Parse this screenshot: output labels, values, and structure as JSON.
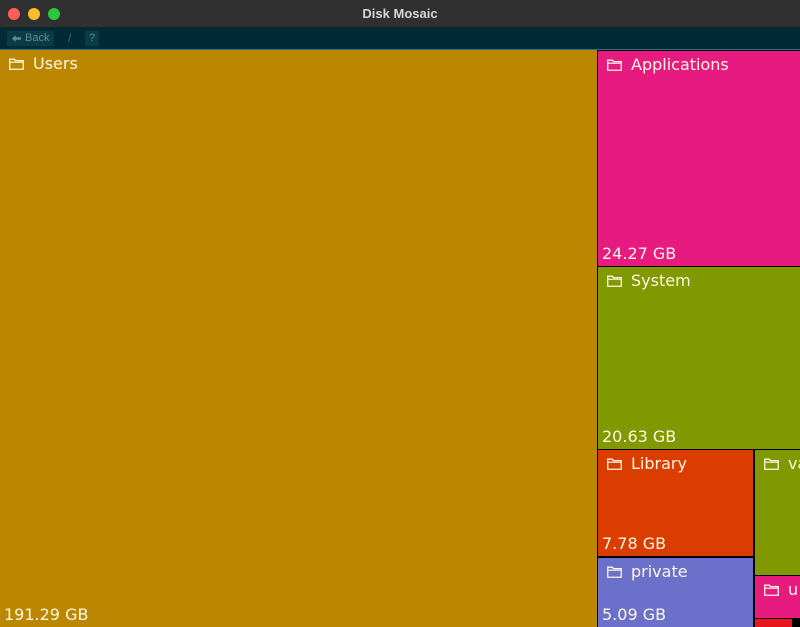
{
  "window": {
    "title": "Disk Mosaic"
  },
  "toolbar": {
    "back_label": "Back",
    "separator": "/",
    "help_label": "?"
  },
  "tiles": {
    "users": {
      "name": "Users",
      "size": "191.29 GB",
      "color": "#bb8700"
    },
    "applications": {
      "name": "Applications",
      "size": "24.27 GB",
      "color": "#e71a80"
    },
    "system": {
      "name": "System",
      "size": "20.63 GB",
      "color": "#819900"
    },
    "library": {
      "name": "Library",
      "size": "7.78 GB",
      "color": "#db3d00"
    },
    "private": {
      "name": "private",
      "size": "5.09 GB",
      "color": "#6b71ca"
    },
    "var": {
      "name": "va",
      "color": "#819900"
    },
    "usr": {
      "name": "u",
      "color": "#e71a80"
    },
    "small": {
      "color": "#e8141e"
    }
  },
  "icons": {
    "back": "back-arrow-icon",
    "folder": "folder-icon"
  }
}
